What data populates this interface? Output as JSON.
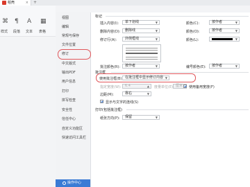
{
  "tabbar": {
    "tab_title": "稻壳",
    "new_tab": "+"
  },
  "toolbar": {
    "items": [
      "样式",
      "段落",
      "文本",
      "表格"
    ],
    "glyphs": [
      "⌘",
      "¶",
      "A",
      "▦"
    ]
  },
  "nav": {
    "items": [
      "视图",
      "编辑",
      "常规与保存",
      "文件位置",
      "修订",
      "中文版式",
      "输出PDF",
      "用户信息",
      "打印",
      "拼写检查",
      "安全性",
      "信任中心",
      "自定义功能区",
      "快速访问工具栏"
    ],
    "selected": "修订",
    "help": "操作中心"
  },
  "markup": {
    "title": "标记",
    "insert_label": "插入内容(I):",
    "insert_value": "单下划线",
    "insert_color_label": "颜色(C):",
    "insert_color_value": "按作者",
    "delete_label": "删除内容(D):",
    "delete_value": "删除线",
    "delete_color_label": "颜色(O):",
    "delete_color_value": "按作者",
    "revline_label": "修订行(A):",
    "revline_value": "外侧框线",
    "revline_color_label": "颜色(L):",
    "comment_color_label": "批注颜色(R):",
    "comment_color_value": "按作者",
    "border_color_label": "编号颜色(E):",
    "border_color_value": "按作者"
  },
  "balloons": {
    "title": "批注框",
    "use_label": "使用批注框(B):",
    "use_value": "在批注框中显示修订内容",
    "width_label": "指定宽度(W):",
    "width_value": "6.4",
    "unit_label": "度量单位(E):",
    "unit_value": "厘米",
    "use_alt_label": "使用备用宽度(F)",
    "margin_label": "边距(M):",
    "margin_value": "靠右",
    "show_lines_label": "显示与文字的连线(S)"
  },
  "print": {
    "title": "打印(包括批注框)",
    "orient_label": "纸张方向(P):",
    "orient_value": "保留"
  }
}
